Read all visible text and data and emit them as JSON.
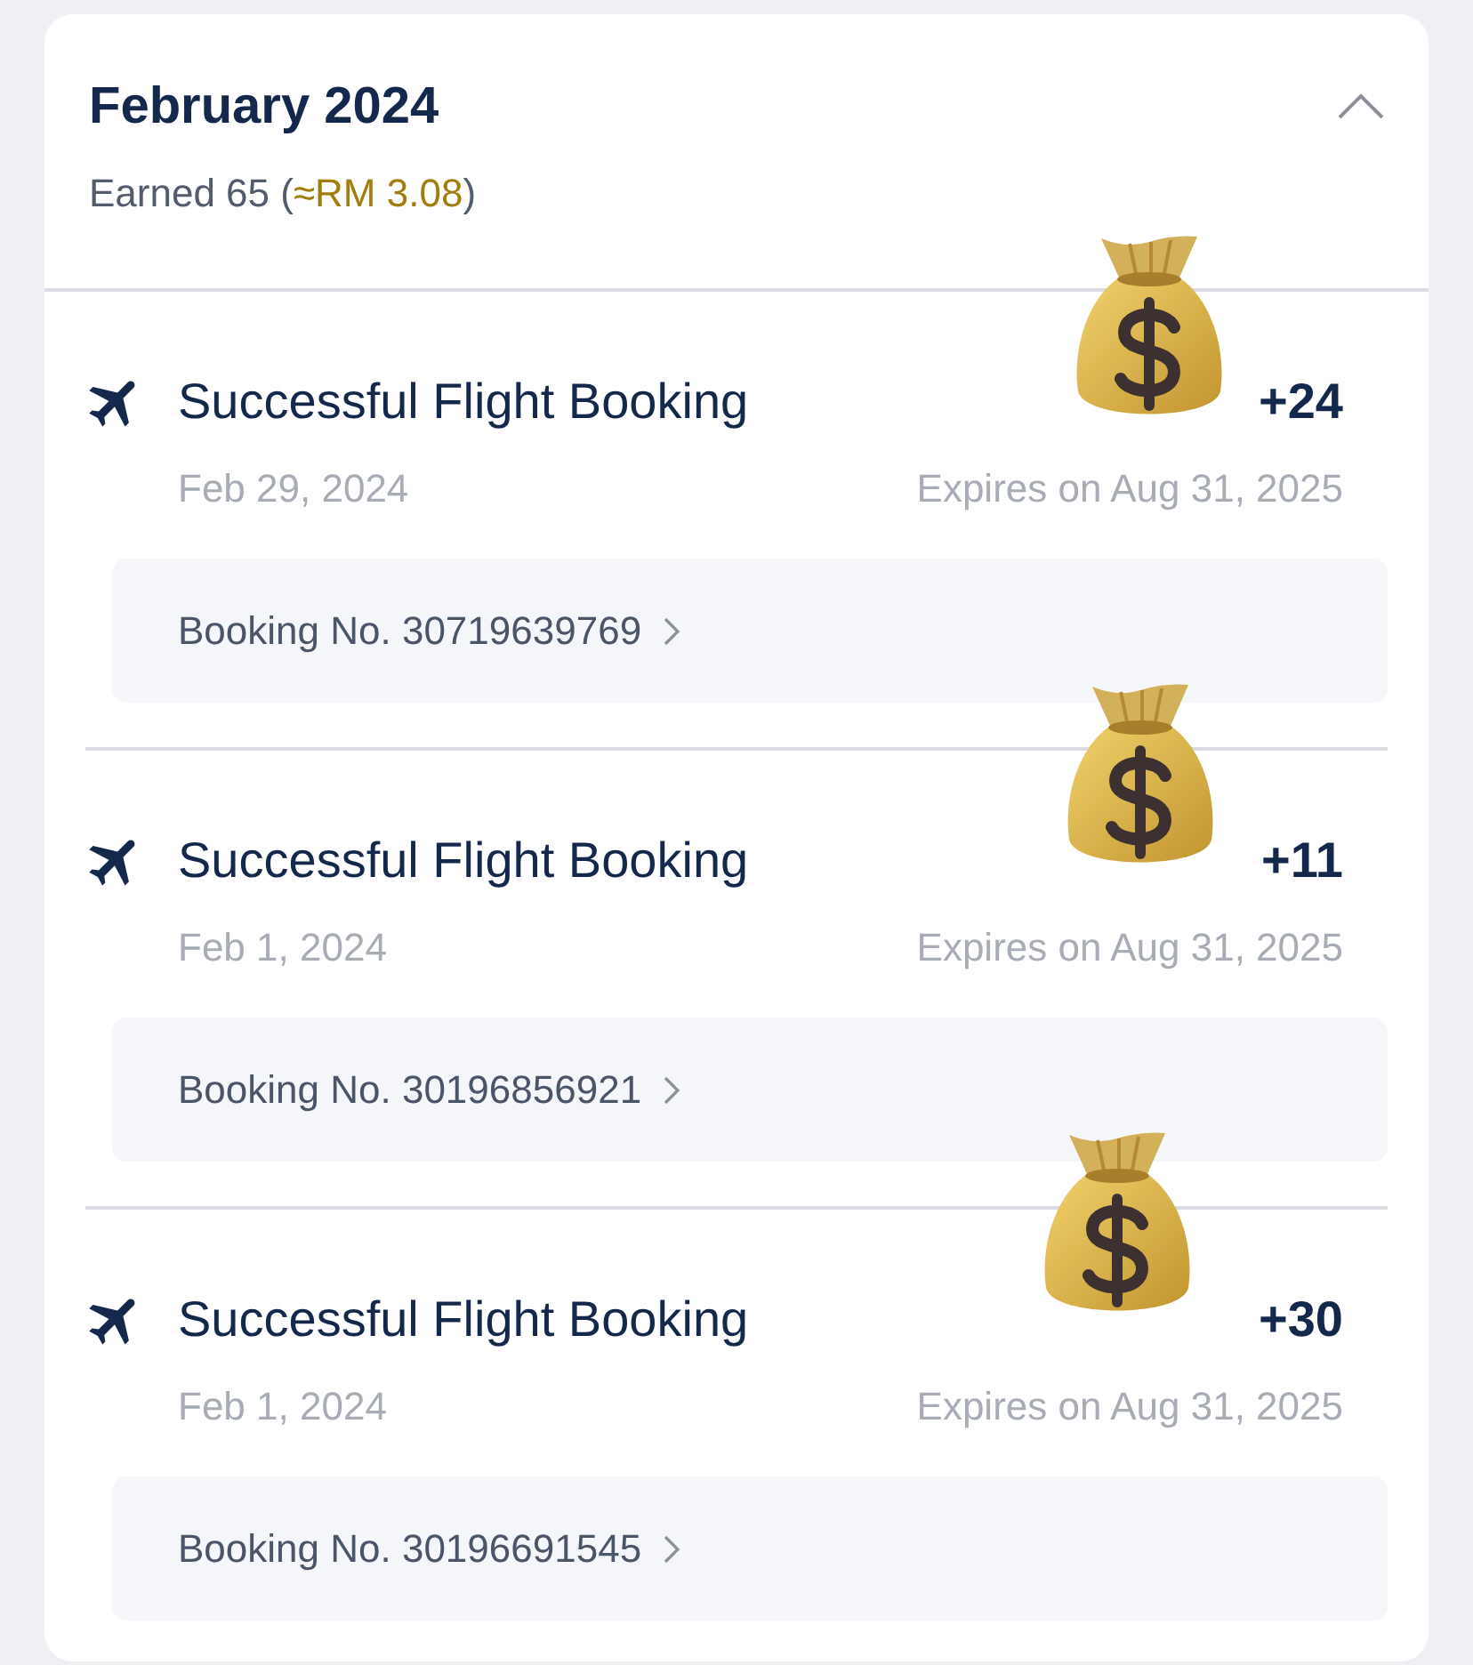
{
  "header": {
    "title": "February 2024",
    "expanded": true,
    "summary": [
      {
        "text": "Earned 65 (",
        "highlighted": false
      },
      {
        "text": "≈RM 3.08",
        "highlighted": true
      },
      {
        "text": ")",
        "highlighted": false
      }
    ]
  },
  "transactions": [
    {
      "title": "Successful Flight Booking",
      "points": "+24",
      "date": "Feb 29, 2024",
      "expiry": "Expires on Aug 31, 2025",
      "booking": "Booking No. 30719639769"
    },
    {
      "title": "Successful Flight Booking",
      "points": "+11",
      "date": "Feb 1, 2024",
      "expiry": "Expires on Aug 31, 2025",
      "booking": "Booking No. 30196856921"
    },
    {
      "title": "Successful Flight Booking",
      "points": "+30",
      "date": "Feb 1, 2024",
      "expiry": "Expires on Aug 31, 2025",
      "booking": "Booking No. 30196691545"
    }
  ]
}
